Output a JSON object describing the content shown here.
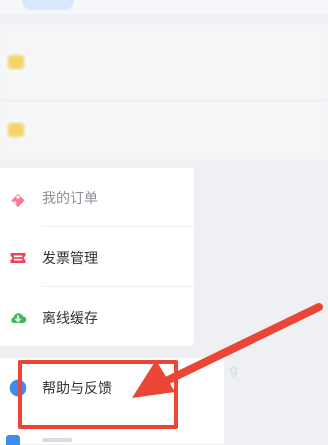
{
  "menu": {
    "items": [
      {
        "label": "我的订单",
        "icon": "ticket-icon",
        "color": "#f37b97"
      },
      {
        "label": "发票管理",
        "icon": "invoice-icon",
        "color": "#ef4457"
      },
      {
        "label": "离线缓存",
        "icon": "cloud-download-icon",
        "color": "#42b760"
      }
    ]
  },
  "help": {
    "label": "帮助与反馈",
    "icon": "help-circle-icon",
    "color": "#3d8cf0"
  },
  "annotation": {
    "highlight_color": "#eb4535",
    "arrow_color": "#eb4535"
  }
}
